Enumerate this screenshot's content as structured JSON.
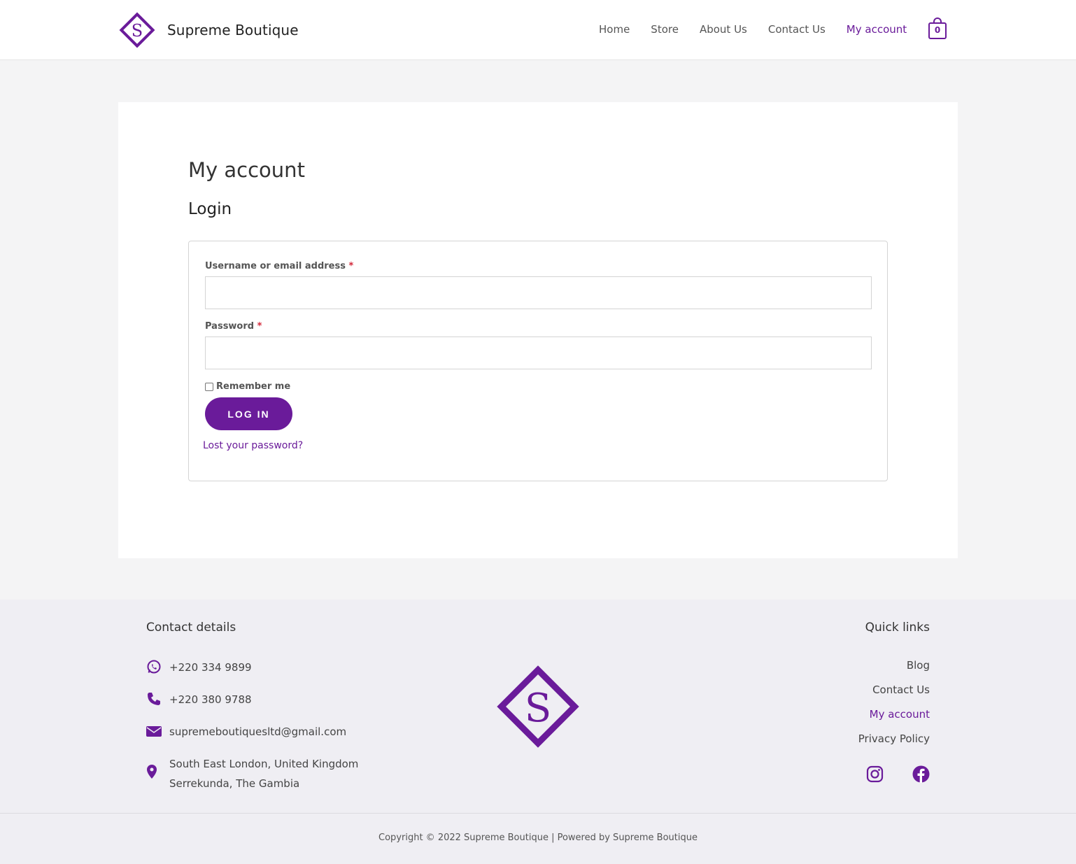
{
  "brand": {
    "name": "Supreme Boutique",
    "logo_letter": "S"
  },
  "nav": {
    "items": [
      "Home",
      "Store",
      "About Us",
      "Contact Us",
      "My account"
    ],
    "active": "My account"
  },
  "cart": {
    "count": "0",
    "icon": "shopping-bag-icon"
  },
  "page": {
    "title": "My account",
    "section": "Login"
  },
  "form": {
    "username_label": "Username or email address",
    "username_value": "",
    "password_label": "Password",
    "password_value": "",
    "required_mark": "*",
    "remember_label": "Remember me",
    "remember_checked": false,
    "submit_label": "LOG IN",
    "lost_password": "Lost your password?"
  },
  "footer": {
    "contact_title": "Contact details",
    "whatsapp": "+220 334 9899",
    "phone": "+220 380 9788",
    "email": "supremeboutiquesltd@gmail.com",
    "address_line1": "South East London, United Kingdom",
    "address_line2": "Serrekunda, The Gambia",
    "quick_links_title": "Quick links",
    "quick_links": [
      "Blog",
      "Contact Us",
      "My account",
      "Privacy Policy"
    ],
    "social": [
      "instagram-icon",
      "facebook-icon"
    ],
    "copyright": "Copyright © 2022 Supreme Boutique | Powered by Supreme Boutique"
  },
  "colors": {
    "accent": "#6a1b9a",
    "required": "#d3283a",
    "page_bg": "#f4f4f5",
    "footer_bg": "#efeef3"
  }
}
